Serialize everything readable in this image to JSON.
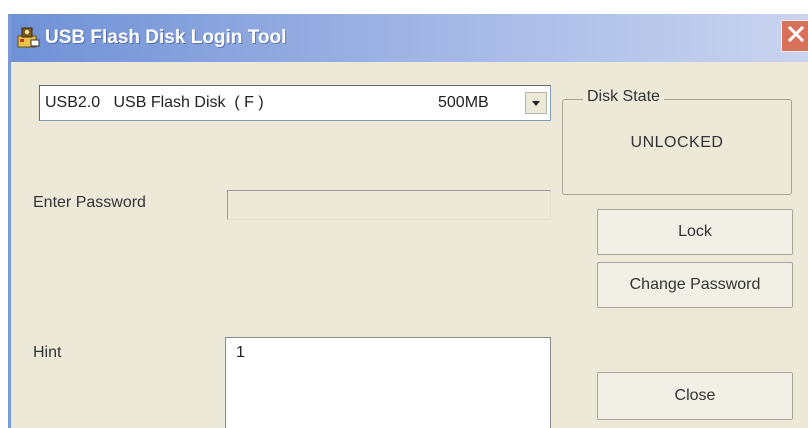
{
  "window": {
    "title": "USB Flash Disk Login Tool",
    "icon": "usb-login-tool-icon",
    "close_glyph": "✕"
  },
  "disk_select": {
    "selected_name": "USB2.0   USB Flash Disk  ( F )",
    "selected_size": "500MB",
    "dropdown_glyph": "▼"
  },
  "disk_state": {
    "label": "Disk State",
    "value": "UNLOCKED"
  },
  "password": {
    "label": "Enter Password",
    "value": ""
  },
  "hint": {
    "label": "Hint",
    "value": "1"
  },
  "buttons": {
    "lock": "Lock",
    "change_password": "Change Password",
    "close": "Close"
  },
  "colors": {
    "title_bar_start": "#6f91d6",
    "title_bar_end": "#c9d4ef",
    "window_bg": "#ece9d8",
    "close_button": "#d9705a"
  }
}
